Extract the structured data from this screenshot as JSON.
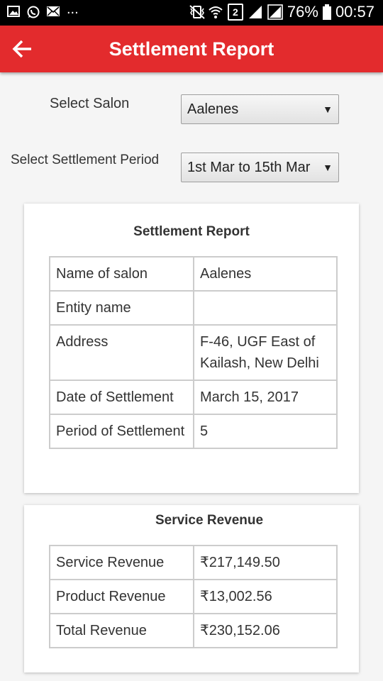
{
  "status_bar": {
    "left_icons": [
      "image-icon",
      "whatsapp-icon",
      "mail-icon"
    ],
    "overflow": "...",
    "sim": "2",
    "battery": "76%",
    "time": "00:57"
  },
  "app_bar": {
    "title": "Settlement Report",
    "back_icon": "arrow-back-icon"
  },
  "form": {
    "salon_label": "Select Salon",
    "salon_value": "Aalenes",
    "period_label": "Select Settlement Period",
    "period_value": "1st Mar to 15th Mar"
  },
  "report": {
    "title": "Settlement Report",
    "rows": [
      {
        "label": "Name of salon",
        "value": "Aalenes"
      },
      {
        "label": "Entity name",
        "value": ""
      },
      {
        "label": "Address",
        "value": "F-46, UGF East of Kailash, New Delhi"
      },
      {
        "label": "Date of Settlement",
        "value": "March 15, 2017"
      },
      {
        "label": "Period of Settlement",
        "value": "5"
      }
    ]
  },
  "revenue": {
    "title": "Service Revenue",
    "rows": [
      {
        "label": "Service Revenue",
        "value": "₹217,149.50"
      },
      {
        "label": "Product Revenue",
        "value": "₹13,002.56"
      },
      {
        "label": "Total Revenue",
        "value": "₹230,152.06"
      }
    ]
  }
}
